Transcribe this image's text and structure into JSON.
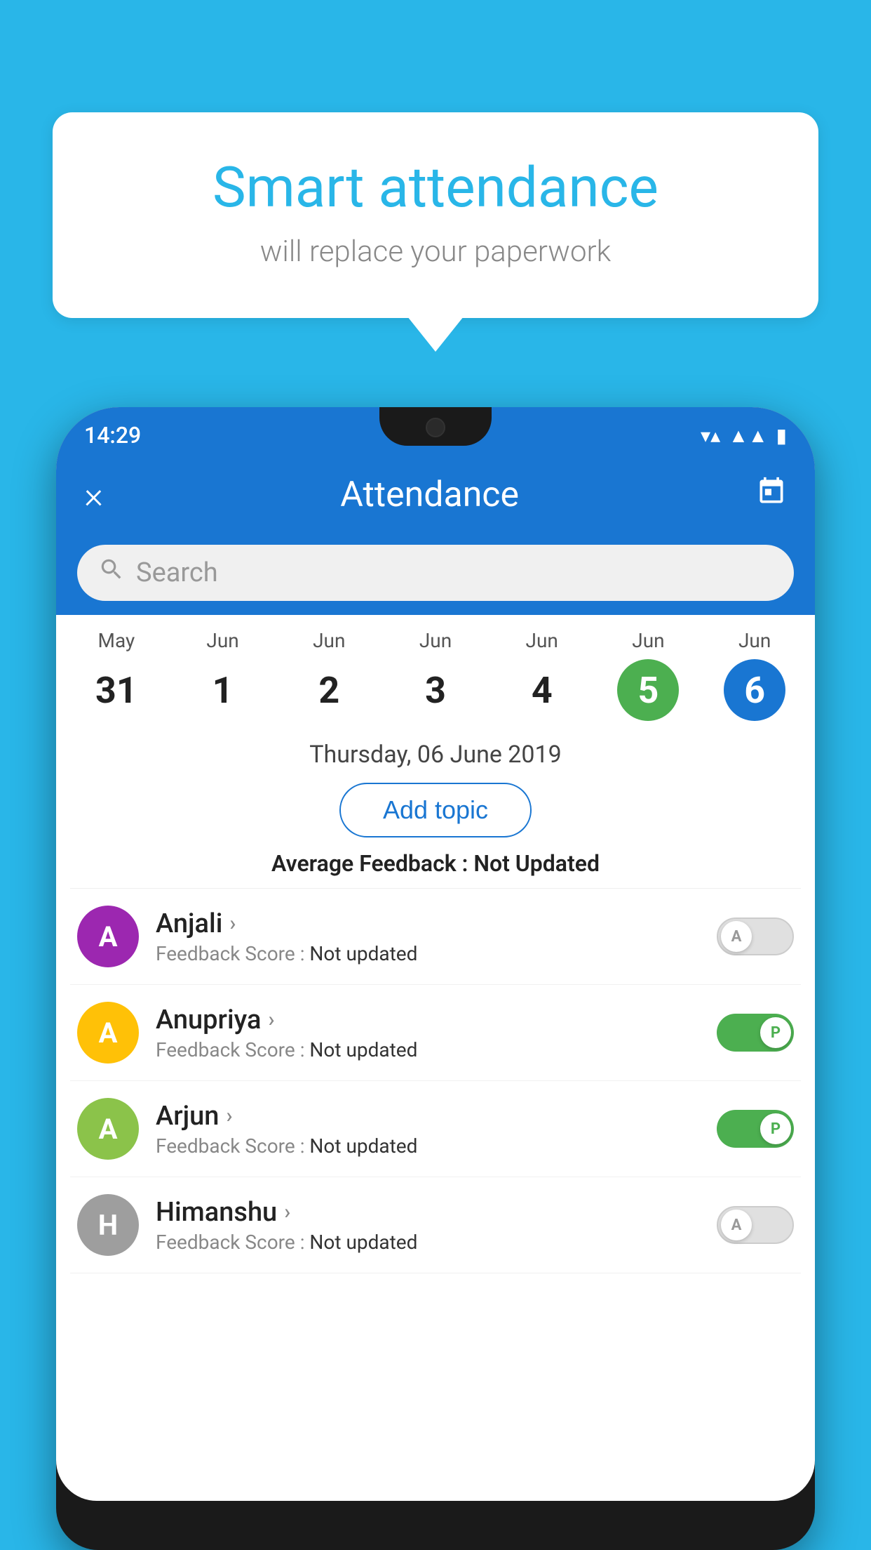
{
  "background_color": "#29B6E8",
  "speech_bubble": {
    "title": "Smart attendance",
    "subtitle": "will replace your paperwork"
  },
  "status_bar": {
    "time": "14:29",
    "icons": [
      "wifi",
      "signal",
      "battery"
    ]
  },
  "app_bar": {
    "title": "Attendance",
    "close_label": "×",
    "calendar_icon": "📅"
  },
  "search": {
    "placeholder": "Search"
  },
  "calendar": {
    "days": [
      {
        "month": "May",
        "date": "31",
        "state": "normal"
      },
      {
        "month": "Jun",
        "date": "1",
        "state": "normal"
      },
      {
        "month": "Jun",
        "date": "2",
        "state": "normal"
      },
      {
        "month": "Jun",
        "date": "3",
        "state": "normal"
      },
      {
        "month": "Jun",
        "date": "4",
        "state": "normal"
      },
      {
        "month": "Jun",
        "date": "5",
        "state": "today"
      },
      {
        "month": "Jun",
        "date": "6",
        "state": "selected"
      }
    ]
  },
  "selected_date": "Thursday, 06 June 2019",
  "add_topic_label": "Add topic",
  "average_feedback": {
    "label": "Average Feedback : ",
    "value": "Not Updated"
  },
  "students": [
    {
      "name": "Anjali",
      "avatar_letter": "A",
      "avatar_color": "#9C27B0",
      "feedback_label": "Feedback Score : ",
      "feedback_value": "Not updated",
      "toggle_state": "off",
      "toggle_label": "A"
    },
    {
      "name": "Anupriya",
      "avatar_letter": "A",
      "avatar_color": "#FFC107",
      "feedback_label": "Feedback Score : ",
      "feedback_value": "Not updated",
      "toggle_state": "on",
      "toggle_label": "P"
    },
    {
      "name": "Arjun",
      "avatar_letter": "A",
      "avatar_color": "#8BC34A",
      "feedback_label": "Feedback Score : ",
      "feedback_value": "Not updated",
      "toggle_state": "on",
      "toggle_label": "P"
    },
    {
      "name": "Himanshu",
      "avatar_letter": "H",
      "avatar_color": "#9E9E9E",
      "feedback_label": "Feedback Score : ",
      "feedback_value": "Not updated",
      "toggle_state": "off",
      "toggle_label": "A"
    }
  ]
}
